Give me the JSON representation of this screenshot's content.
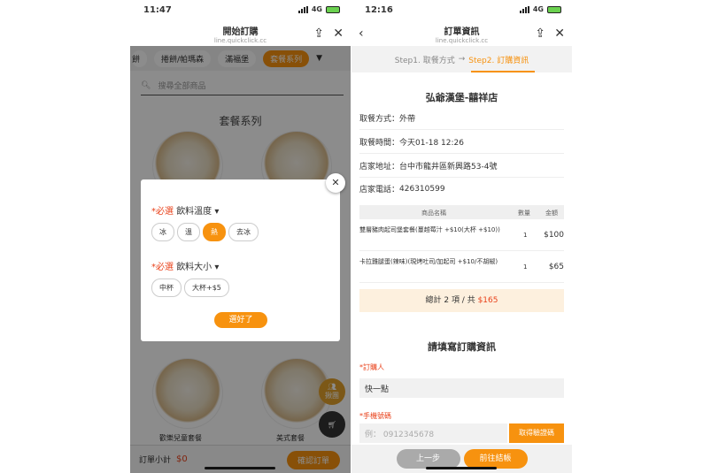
{
  "left": {
    "status": {
      "time": "11:47",
      "net": "4G"
    },
    "nav": {
      "title": "開始訂購",
      "subtitle": "line.quickclick.cc"
    },
    "categories": [
      "餅",
      "捲餅/帕瑪森",
      "滿福堡",
      "套餐系列"
    ],
    "search_placeholder": "搜尋全部商品",
    "section": "套餐系列",
    "items": [
      "歡樂兒童套餐",
      "美式套餐"
    ],
    "subtotal_label": "訂單小計",
    "subtotal": "$0",
    "confirm": "確認訂單",
    "group_label": "揪團",
    "cart_badge": "0",
    "modal": {
      "required": "*必選",
      "temp_title": "飲料溫度",
      "temp_opts": [
        "冰",
        "溫",
        "熱",
        "去冰"
      ],
      "size_title": "飲料大小",
      "size_opts": [
        "中杯",
        "大杯+$5"
      ],
      "ok": "選好了"
    }
  },
  "right": {
    "status": {
      "time": "12:16",
      "net": "4G"
    },
    "nav": {
      "title": "訂單資訊",
      "subtitle": "line.quickclick.cc"
    },
    "step1": "Step1. 取餐方式",
    "arrow": "→",
    "step2": "Step2. 訂購資訊",
    "store": "弘爺漢堡-囍祥店",
    "info": [
      {
        "k": "取餐方式：",
        "v": "外帶"
      },
      {
        "k": "取餐時間：",
        "v": "今天01-18 12:26"
      },
      {
        "k": "店家地址：",
        "v": "台中市龍井區新興路53-4號"
      },
      {
        "k": "店家電話：",
        "v": "426310599"
      }
    ],
    "table_head": {
      "name": "商品名稱",
      "qty": "數量",
      "price": "金額"
    },
    "rows": [
      {
        "name": "雙層豬肉起司堡套餐(蔓越莓汁 +$10(大杯 +$10))",
        "qty": "1",
        "price": "$100"
      },
      {
        "name": "卡拉雞腿蛋(辣味)(現烤吐司/加起司 +$10/不胡椒)",
        "qty": "1",
        "price": "$65"
      }
    ],
    "total_text": "總計 2 項 / 共 ",
    "total": "$165",
    "form_title": "請填寫訂購資訊",
    "buyer_label": "*訂購人",
    "buyer": "快一點",
    "phone_label": "*手機號碼",
    "phone_placeholder": "例： 0912345678",
    "get_code": "取得驗證碼",
    "prev": "上一步",
    "next": "前往結帳"
  }
}
